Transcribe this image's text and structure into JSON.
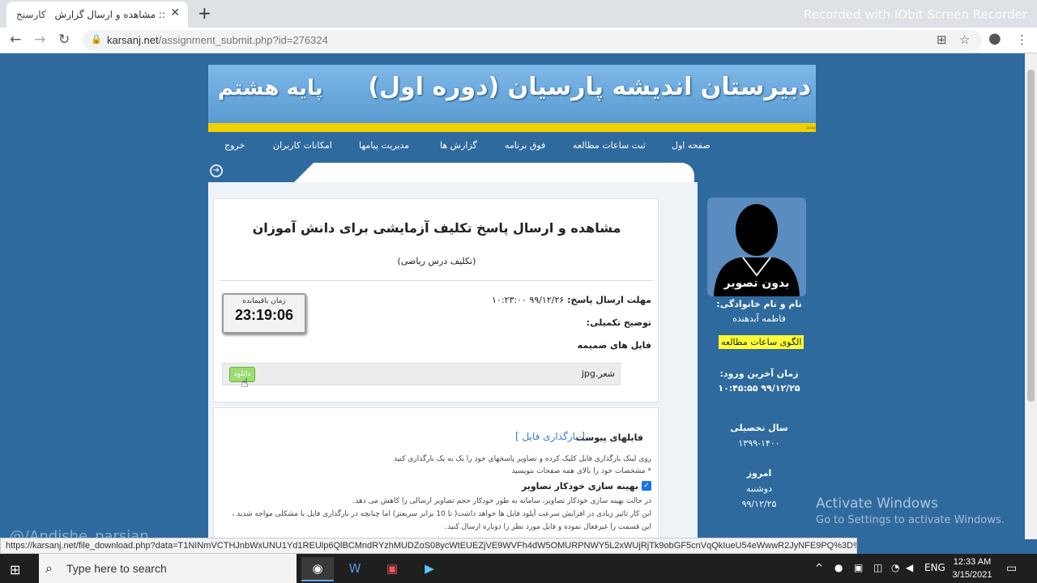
{
  "browser": {
    "tab_favicon": "کارسنج",
    "tab_title": ":: مشاهده و ارسال گزارش ::",
    "tab_close": "✕",
    "new_tab": "+",
    "recording_watermark": "Recorded with IObit Screen Recorder",
    "url_host": "karsanj.net",
    "url_path": "/assignment_submit.php?id=276324",
    "status_url": "https://karsanj.net/file_download.php?data=T1NINmVCTHJnbWxUNU1Yd1REUlp6QlBCMndRYzhMUDZoS08ycWtEUEZjVE9WVFh4dW5OMURPNWY5L2xWUjRjTk9obGF5cnVqQkIueU54eWwwR2JyNFE9PQ%3D%3D"
  },
  "site": {
    "school_name": "دبیرستان اندیشه پارسیان (دوره اول)",
    "grade": "پایه هشتم",
    "marquee": "بنند",
    "nav": [
      "صفحه اول",
      "ثبت ساعات مطالعه",
      "فوق برنامه",
      "گزارش ها",
      "مدیریت پیامها",
      "امکانات کاربران",
      "خروج"
    ]
  },
  "assignment": {
    "title": "مشاهده و ارسال پاسخ تکلیف آزمایشی برای دانش آموزان",
    "subtitle": "(تکلیف درس ریاضی)",
    "deadline_label": "مهلت ارسال پاسخ:",
    "deadline_value": "۹۹/۱۲/۲۶ ۱۰:۲۳:۰۰",
    "description_label": "توضیح تکمیلی:",
    "attachments_label": "فایل های ضمیمه",
    "timer_label": "زمان باقیمانده",
    "timer_value": "23:19:06",
    "file_name": "شعر.jpg",
    "download_label": "دانلود"
  },
  "upload": {
    "title": "فایلهای پیوست",
    "link": "[ بارگذاری فایل ]",
    "hint1": "روی لینک بارگذاری فایل کلیک کرده و تصاویر پاسخهای خود را یک به یک بارگذاری کنید",
    "hint2": "* مشخصات خود را بالای همه صفحات بنویسید",
    "optimize_label": "بهینه سازی خودکار تصاویر",
    "optimize_desc1": "در حالت بهینه سازی خودکار تصاویر، سامانه به طور خودکار حجم تصاویر ارسالی را کاهش می دهد.",
    "optimize_desc2": "این کار تاثیر زیادی در افزایش سرعت آپلود فایل ها خواهد داشت( تا 10 برابر سریعتر) اما چنانچه در بارگذاری فایل با مشکلی مواجه شدید ،",
    "optimize_desc3": "این قسمت را غیرفعال نموده و فایل مورد نظر را دوباره ارسال کنید."
  },
  "sidebar": {
    "no_photo": "بدون تصویر",
    "name_label": "نام و نام خانوادگی:",
    "name_value": "فاطمه آبدهنده",
    "study_link": "الگوی ساعات مطالعه",
    "last_login_label": "زمان آخرین ورود:",
    "last_login_value": "۹۹/۱۲/۲۵ ۱۰:۴۵:۵۵",
    "year_label": "سال تحصیلی",
    "year_value": "۱۳۹۹-۱۴۰۰",
    "today_label": "امروز",
    "today_day": "دوشنبه",
    "today_date": "۹۹/۱۲/۲۵"
  },
  "overlays": {
    "activate_title": "Activate Windows",
    "activate_sub": "Go to Settings to activate Windows.",
    "channel": "@/Andishe_parsian"
  },
  "taskbar": {
    "search_placeholder": "Type here to search",
    "lang": "ENG",
    "time": "12:33 AM",
    "date": "3/15/2021"
  }
}
